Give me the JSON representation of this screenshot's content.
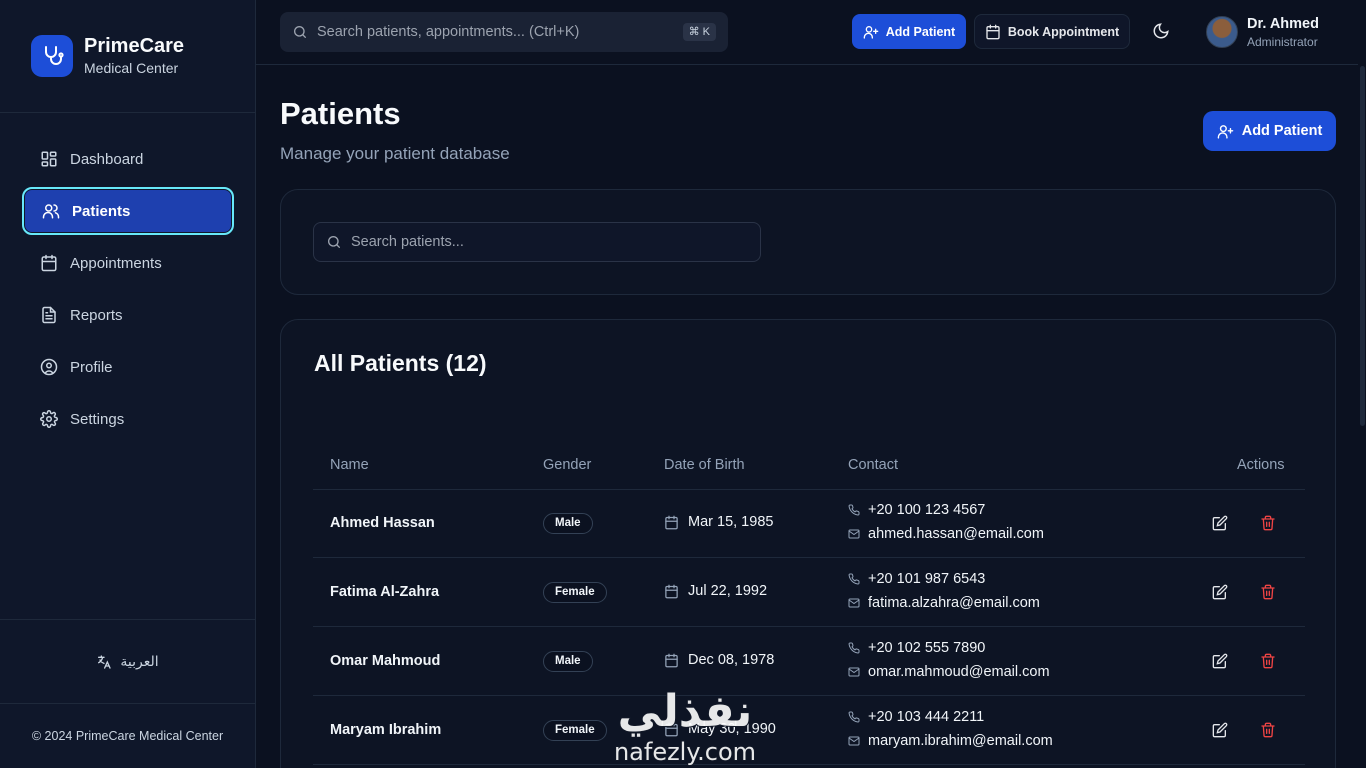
{
  "brand": {
    "name": "PrimeCare",
    "subtitle": "Medical Center"
  },
  "sidebar": {
    "items": [
      {
        "label": "Dashboard",
        "icon": "dashboard-icon"
      },
      {
        "label": "Patients",
        "icon": "users-icon",
        "active": true
      },
      {
        "label": "Appointments",
        "icon": "calendar-icon"
      },
      {
        "label": "Reports",
        "icon": "file-text-icon"
      },
      {
        "label": "Profile",
        "icon": "user-circle-icon"
      },
      {
        "label": "Settings",
        "icon": "gear-icon"
      }
    ],
    "language": "العربية",
    "copyright": "© 2024 PrimeCare Medical Center"
  },
  "topbar": {
    "search_placeholder": "Search patients, appointments... (Ctrl+K)",
    "shortcut": "⌘ K",
    "add_patient": "Add Patient",
    "book_appointment": "Book Appointment",
    "user": {
      "name": "Dr. Ahmed",
      "role": "Administrator"
    }
  },
  "page": {
    "title": "Patients",
    "subtitle": "Manage your patient database",
    "add_button": "Add Patient",
    "search_placeholder": "Search patients..."
  },
  "table": {
    "title": "All Patients (12)",
    "columns": [
      "Name",
      "Gender",
      "Date of Birth",
      "Contact",
      "Actions"
    ],
    "rows": [
      {
        "name": "Ahmed Hassan",
        "gender": "Male",
        "dob": "Mar 15, 1985",
        "phone": "+20 100 123 4567",
        "email": "ahmed.hassan@email.com"
      },
      {
        "name": "Fatima Al-Zahra",
        "gender": "Female",
        "dob": "Jul 22, 1992",
        "phone": "+20 101 987 6543",
        "email": "fatima.alzahra@email.com"
      },
      {
        "name": "Omar Mahmoud",
        "gender": "Male",
        "dob": "Dec 08, 1978",
        "phone": "+20 102 555 7890",
        "email": "omar.mahmoud@email.com"
      },
      {
        "name": "Maryam Ibrahim",
        "gender": "Female",
        "dob": "May 30, 1990",
        "phone": "+20 103 444 2211",
        "email": "maryam.ibrahim@email.com"
      }
    ]
  },
  "watermark": {
    "arabic": "نفذلي",
    "latin": "nafezly.com"
  },
  "colors": {
    "primary": "#1d4ed8",
    "active_ring": "#67e8f9",
    "danger": "#ef4444",
    "background": "#0b1120"
  }
}
